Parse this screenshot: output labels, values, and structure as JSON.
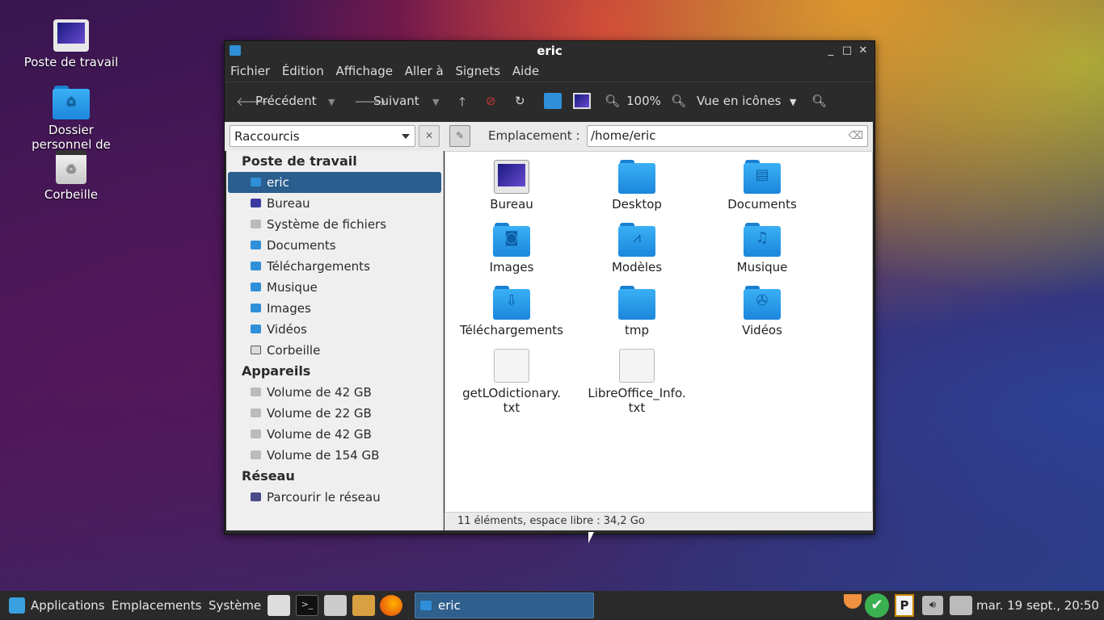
{
  "desktop": {
    "icons": [
      {
        "label": "Poste de travail"
      },
      {
        "label": "Dossier personnel de eric"
      },
      {
        "label": "Corbeille"
      }
    ]
  },
  "window": {
    "title": "eric",
    "menu": [
      "Fichier",
      "Édition",
      "Affichage",
      "Aller à",
      "Signets",
      "Aide"
    ],
    "toolbar": {
      "back_label": "Précédent",
      "forward_label": "Suivant",
      "zoom": "100%",
      "view_mode": "Vue en icônes"
    },
    "location": {
      "side_pane_select": "Raccourcis",
      "label": "Emplacement :",
      "path": "/home/eric"
    },
    "sidebar": {
      "sections": [
        {
          "heading": "Poste de travail",
          "items": [
            "eric",
            "Bureau",
            "Système de fichiers",
            "Documents",
            "Téléchargements",
            "Musique",
            "Images",
            "Vidéos",
            "Corbeille"
          ]
        },
        {
          "heading": "Appareils",
          "items": [
            "Volume de 42 GB",
            "Volume de 22 GB",
            "Volume de 42 GB",
            "Volume de 154 GB"
          ]
        },
        {
          "heading": "Réseau",
          "items": [
            "Parcourir le réseau"
          ]
        }
      ],
      "selected": "eric"
    },
    "files": [
      {
        "name": "Bureau",
        "kind": "desktop-folder"
      },
      {
        "name": "Desktop",
        "kind": "folder"
      },
      {
        "name": "Documents",
        "kind": "documents-folder"
      },
      {
        "name": "Images",
        "kind": "images-folder"
      },
      {
        "name": "Modèles",
        "kind": "templates-folder"
      },
      {
        "name": "Musique",
        "kind": "music-folder"
      },
      {
        "name": "Téléchargements",
        "kind": "downloads-folder"
      },
      {
        "name": "tmp",
        "kind": "folder"
      },
      {
        "name": "Vidéos",
        "kind": "videos-folder"
      },
      {
        "name_line1": "getLOdictionary.",
        "name_line2": "txt",
        "kind": "text-file"
      },
      {
        "name_line1": "LibreOffice_Info.",
        "name_line2": "txt",
        "kind": "text-file"
      }
    ],
    "status": "11 éléments, espace libre : 34,2 Go"
  },
  "taskbar": {
    "menus": [
      "Applications",
      "Emplacements",
      "Système"
    ],
    "active_task": "eric",
    "clock": "mar. 19 sept., 20:50"
  },
  "colors": {
    "accent": "#2a5e8e",
    "folder": "#1c86dc",
    "window_chrome": "#2b2b2b"
  }
}
